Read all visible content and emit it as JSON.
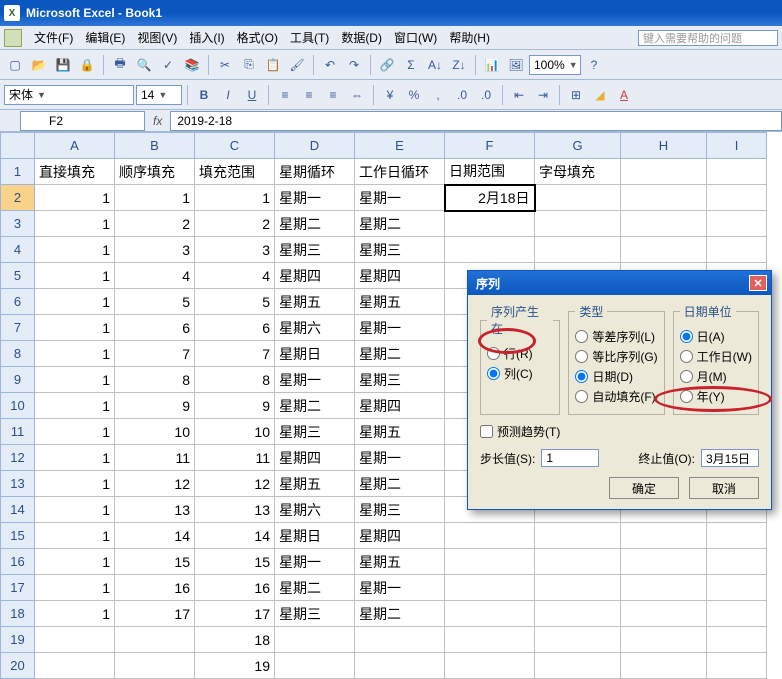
{
  "app": {
    "title": "Microsoft Excel - Book1"
  },
  "menu": {
    "items": [
      "文件(F)",
      "编辑(E)",
      "视图(V)",
      "插入(I)",
      "格式(O)",
      "工具(T)",
      "数据(D)",
      "窗口(W)",
      "帮助(H)"
    ],
    "askbox": "键入需要帮助的问题"
  },
  "tb2": {
    "font": "宋体",
    "size": "14",
    "zoom": "100%"
  },
  "formula": {
    "cellref": "F2",
    "value": "2019-2-18"
  },
  "cols": [
    "A",
    "B",
    "C",
    "D",
    "E",
    "F",
    "G",
    "H",
    "I"
  ],
  "headers": [
    "直接填充",
    "顺序填充",
    "填充范围",
    "星期循环",
    "工作日循环",
    "日期范围",
    "字母填充"
  ],
  "selected_cell": "2月18日",
  "rows": [
    {
      "r": 2,
      "a": "1",
      "b": "1",
      "c": "1",
      "d": "星期一",
      "e": "星期一"
    },
    {
      "r": 3,
      "a": "1",
      "b": "2",
      "c": "2",
      "d": "星期二",
      "e": "星期二"
    },
    {
      "r": 4,
      "a": "1",
      "b": "3",
      "c": "3",
      "d": "星期三",
      "e": "星期三"
    },
    {
      "r": 5,
      "a": "1",
      "b": "4",
      "c": "4",
      "d": "星期四",
      "e": "星期四"
    },
    {
      "r": 6,
      "a": "1",
      "b": "5",
      "c": "5",
      "d": "星期五",
      "e": "星期五"
    },
    {
      "r": 7,
      "a": "1",
      "b": "6",
      "c": "6",
      "d": "星期六",
      "e": "星期一"
    },
    {
      "r": 8,
      "a": "1",
      "b": "7",
      "c": "7",
      "d": "星期日",
      "e": "星期二"
    },
    {
      "r": 9,
      "a": "1",
      "b": "8",
      "c": "8",
      "d": "星期一",
      "e": "星期三"
    },
    {
      "r": 10,
      "a": "1",
      "b": "9",
      "c": "9",
      "d": "星期二",
      "e": "星期四"
    },
    {
      "r": 11,
      "a": "1",
      "b": "10",
      "c": "10",
      "d": "星期三",
      "e": "星期五"
    },
    {
      "r": 12,
      "a": "1",
      "b": "11",
      "c": "11",
      "d": "星期四",
      "e": "星期一"
    },
    {
      "r": 13,
      "a": "1",
      "b": "12",
      "c": "12",
      "d": "星期五",
      "e": "星期二"
    },
    {
      "r": 14,
      "a": "1",
      "b": "13",
      "c": "13",
      "d": "星期六",
      "e": "星期三"
    },
    {
      "r": 15,
      "a": "1",
      "b": "14",
      "c": "14",
      "d": "星期日",
      "e": "星期四"
    },
    {
      "r": 16,
      "a": "1",
      "b": "15",
      "c": "15",
      "d": "星期一",
      "e": "星期五"
    },
    {
      "r": 17,
      "a": "1",
      "b": "16",
      "c": "16",
      "d": "星期二",
      "e": "星期一"
    },
    {
      "r": 18,
      "a": "1",
      "b": "17",
      "c": "17",
      "d": "星期三",
      "e": "星期二"
    },
    {
      "r": 19,
      "a": "",
      "b": "",
      "c": "18",
      "d": "",
      "e": ""
    },
    {
      "r": 20,
      "a": "",
      "b": "",
      "c": "19",
      "d": "",
      "e": ""
    }
  ],
  "dlg": {
    "title": "序列",
    "grp_in": "序列产生在",
    "opt_row": "行(R)",
    "opt_col": "列(C)",
    "grp_type": "类型",
    "opt_arith": "等差序列(L)",
    "opt_geom": "等比序列(G)",
    "opt_date": "日期(D)",
    "opt_autofill": "自动填充(F)",
    "grp_unit": "日期单位",
    "opt_day": "日(A)",
    "opt_wday": "工作日(W)",
    "opt_month": "月(M)",
    "opt_year": "年(Y)",
    "chk_trend": "预测趋势(T)",
    "lbl_step": "步长值(S):",
    "val_step": "1",
    "lbl_end": "终止值(O):",
    "val_end": "3月15日",
    "btn_ok": "确定",
    "btn_cancel": "取消"
  }
}
